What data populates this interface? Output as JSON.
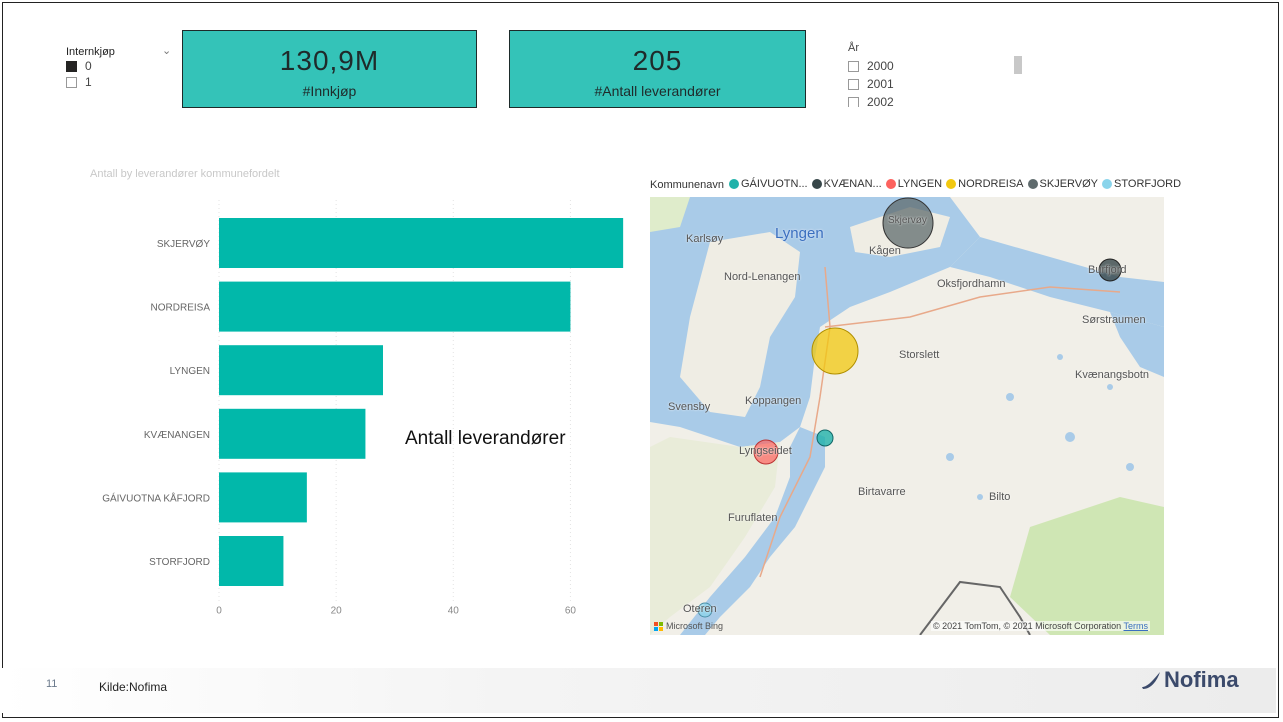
{
  "slicer_intern": {
    "title": "Internkjøp",
    "options": [
      {
        "label": "0",
        "checked": true
      },
      {
        "label": "1",
        "checked": false
      }
    ]
  },
  "cards": [
    {
      "value": "130,9M",
      "label": "#Innkjøp"
    },
    {
      "value": "205",
      "label": "#Antall leverandører"
    }
  ],
  "year_slicer": {
    "title": "År",
    "options": [
      "2000",
      "2001",
      "2002"
    ]
  },
  "bar_chart": {
    "title": "Antall by leverandører kommunefordelt",
    "overlay_text": "Antall leverandører"
  },
  "chart_data": {
    "type": "bar",
    "orientation": "horizontal",
    "title": "Antall by leverandører kommunefordelt",
    "categories": [
      "SKJERVØY",
      "NORDREISA",
      "LYNGEN",
      "KVÆNANGEN",
      "GÁIVUOTNA KÅFJORD",
      "STORFJORD"
    ],
    "values": [
      69,
      60,
      28,
      25,
      15,
      11
    ],
    "xlim": [
      0,
      70
    ],
    "xticks": [
      0,
      20,
      40,
      60
    ],
    "grid": true,
    "color": "#01b8aa"
  },
  "map": {
    "legend_title": "Kommunenavn",
    "legend": [
      {
        "label": "GÁIVUOTN...",
        "color": "#20b2aa"
      },
      {
        "label": "KVÆNAN...",
        "color": "#374649"
      },
      {
        "label": "LYNGEN",
        "color": "#fd625e"
      },
      {
        "label": "NORDREISA",
        "color": "#f2c80f"
      },
      {
        "label": "SKJERVØY",
        "color": "#5f6b6d"
      },
      {
        "label": "STORFJORD",
        "color": "#8ad4eb"
      }
    ],
    "places": {
      "karlsoy": "Karlsøy",
      "lyngen": "Lyngen",
      "kagen": "Kågen",
      "skjervoy": "Skjervøy",
      "burfjord": "Burfjord",
      "nord_lenangen": "Nord-Lenangen",
      "oksfjordhamn": "Oksfjordhamn",
      "sorstraumen": "Sørstraumen",
      "storslett": "Storslett",
      "kvaenangsbotn": "Kvænangsbotn",
      "svensby": "Svensby",
      "koppangen": "Koppangen",
      "lyngseidet": "Lyngseidet",
      "birtavarre": "Birtavarre",
      "bilto": "Bilto",
      "furuflaten": "Furuflaten",
      "oteren": "Oteren"
    },
    "credit": "© 2021 TomTom, © 2021 Microsoft Corporation",
    "terms": "Terms",
    "bing": "Microsoft Bing"
  },
  "footer": {
    "slide_number": "11",
    "source": "Kilde:Nofima",
    "brand": "Nofima"
  }
}
